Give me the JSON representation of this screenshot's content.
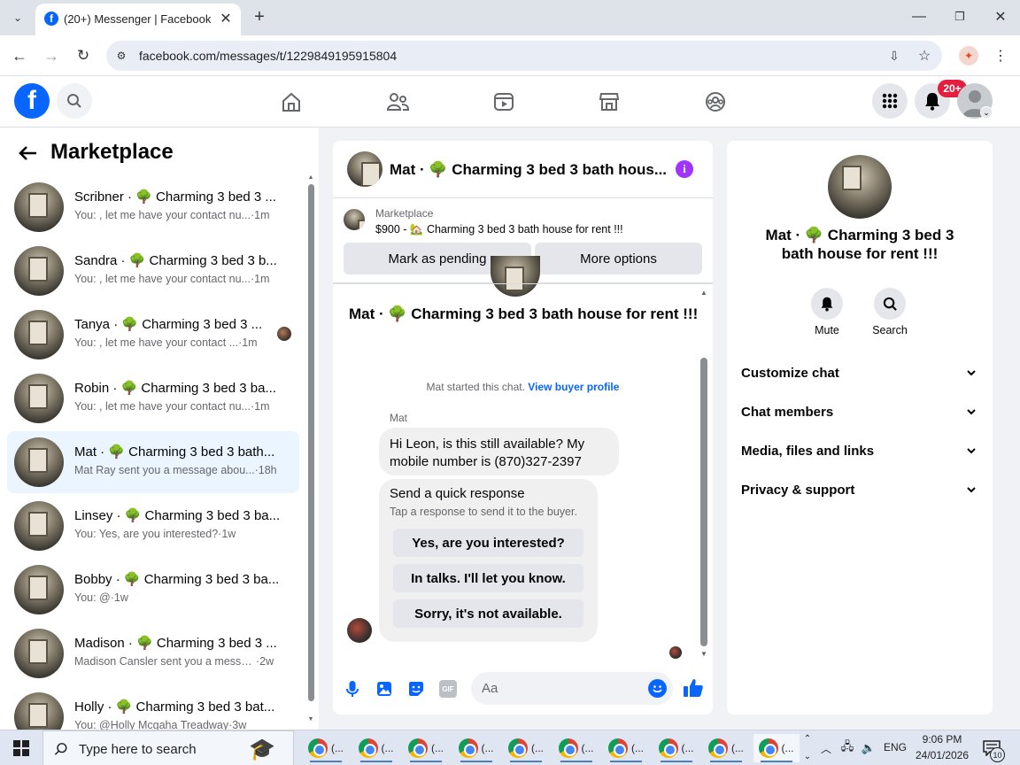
{
  "browser": {
    "tab_title": "(20+) Messenger | Facebook",
    "url": "facebook.com/messages/t/1229849195915804"
  },
  "header": {
    "notifications_badge": "20+"
  },
  "left": {
    "title": "Marketplace",
    "conversations": [
      {
        "title": "Scribner · 🌳 Charming 3 bed 3 ...",
        "sub": "You: , let me have your contact nu...",
        "time": "·1m"
      },
      {
        "title": "Sandra · 🌳 Charming 3 bed 3 b...",
        "sub": "You: , let me have your contact nu...",
        "time": "·1m"
      },
      {
        "title": "Tanya · 🌳 Charming 3 bed 3 ...",
        "sub": "You: , let me have your contact ...",
        "time": "·1m"
      },
      {
        "title": "Robin · 🌳 Charming 3 bed 3 ba...",
        "sub": "You: , let me have your contact nu...",
        "time": "·1m"
      },
      {
        "title": "Mat · 🌳 Charming 3 bed 3 bath...",
        "sub": "Mat Ray sent you a message abou...",
        "time": "·18h"
      },
      {
        "title": "Linsey · 🌳 Charming 3 bed 3 ba...",
        "sub": "You: Yes, are you interested?",
        "time": "·1w"
      },
      {
        "title": "Bobby · 🌳 Charming 3 bed 3 ba...",
        "sub": "You: @",
        "time": "·1w"
      },
      {
        "title": "Madison · 🌳 Charming 3 bed 3 ...",
        "sub": "Madison Cansler sent you a messa...",
        "time": "·2w"
      },
      {
        "title": "Holly · 🌳 Charming 3 bed 3 bat...",
        "sub": "You: @Holly Mcgaha Treadway",
        "time": "·3w"
      }
    ]
  },
  "chat": {
    "header_title": "Mat · 🌳 Charming 3 bed 3 bath hous...",
    "listing_label": "Marketplace",
    "listing_text": "$900 - 🏡 Charming 3 bed 3 bath house for rent !!!",
    "mark_pending": "Mark as pending",
    "more_options": "More options",
    "banner_title": "Mat · 🌳 Charming 3 bed 3 bath house for rent !!!",
    "started_text": "Mat started this chat.",
    "view_profile": "View buyer profile",
    "sender_name": "Mat",
    "message": "Hi Leon, is this still available? My mobile number is (870)327-2397",
    "quick_title": "Send a quick response",
    "quick_sub": "Tap a response to send it to the buyer.",
    "quick_replies": [
      "Yes, are you interested?",
      "In talks. I'll let you know.",
      "Sorry, it's not available."
    ],
    "composer_placeholder": "Aa"
  },
  "info": {
    "title": "Mat · 🌳 Charming 3 bed 3 bath house for rent !!!",
    "mute": "Mute",
    "search": "Search",
    "rows": [
      "Customize chat",
      "Chat members",
      "Media, files and links",
      "Privacy & support"
    ]
  },
  "taskbar": {
    "search_placeholder": "Type here to search",
    "app_label": "(...",
    "lang": "ENG",
    "time": "9:06 PM",
    "date": "24/01/2026",
    "notif_count": "10"
  },
  "colors": {
    "fb_blue": "#0866ff",
    "purple_info": "#a033ff",
    "badge_red": "#e41e3f"
  }
}
